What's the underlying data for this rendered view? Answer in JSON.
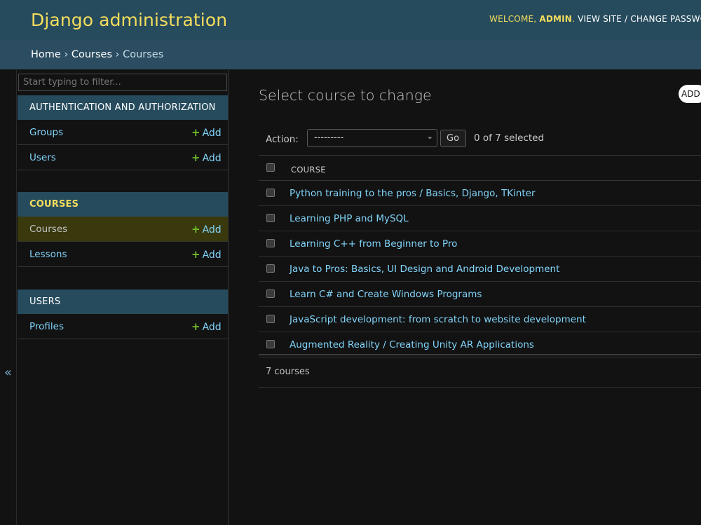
{
  "header": {
    "site_name": "Django administration",
    "welcome": "WELCOME,",
    "username": "ADMIN",
    "separator_dot": ".",
    "view_site": "VIEW SITE",
    "slash": "/",
    "change_password": "CHANGE PASSWORD /"
  },
  "breadcrumbs": {
    "home": "Home",
    "app": "Courses",
    "model": "Courses",
    "sep": "›"
  },
  "sidebar": {
    "filter_placeholder": "Start typing to filter...",
    "collapse_glyph": "«",
    "modules": [
      {
        "caption": "AUTHENTICATION AND AUTHORIZATION",
        "models": [
          {
            "label": "Groups",
            "add": "Add"
          },
          {
            "label": "Users",
            "add": "Add"
          }
        ]
      },
      {
        "caption": "COURSES",
        "models": [
          {
            "label": "Courses",
            "add": "Add"
          },
          {
            "label": "Lessons",
            "add": "Add"
          }
        ]
      },
      {
        "caption": "USERS",
        "models": [
          {
            "label": "Profiles",
            "add": "Add"
          }
        ]
      }
    ],
    "plus_glyph": "+"
  },
  "content": {
    "title": "Select course to change",
    "add_button": "ADD",
    "action_label": "Action:",
    "action_value": "---------",
    "go": "Go",
    "selected": "0 of 7 selected",
    "column_header": "COURSE",
    "rows": [
      "Python training to the pros / Basics, Django, TKinter",
      "Learning PHP and MySQL",
      "Learning C++ from Beginner to Pro",
      "Java to Pros: Basics, UI Design and Android Development",
      "Learn C# and Create Windows Programs",
      "JavaScript development: from scratch to website development",
      "Augmented Reality / Creating Unity AR Applications"
    ],
    "count": "7 courses"
  },
  "colors": {
    "header_bg": "#264b5d",
    "accent_yellow": "#f5dd5d",
    "link_blue": "#81d4fa",
    "add_green": "#70bf2b",
    "selected_row": "#39390d"
  },
  "icons": {
    "collapse": "double-chevron-left-icon",
    "add": "plus-icon",
    "select_arrow": "chevron-down-icon"
  }
}
